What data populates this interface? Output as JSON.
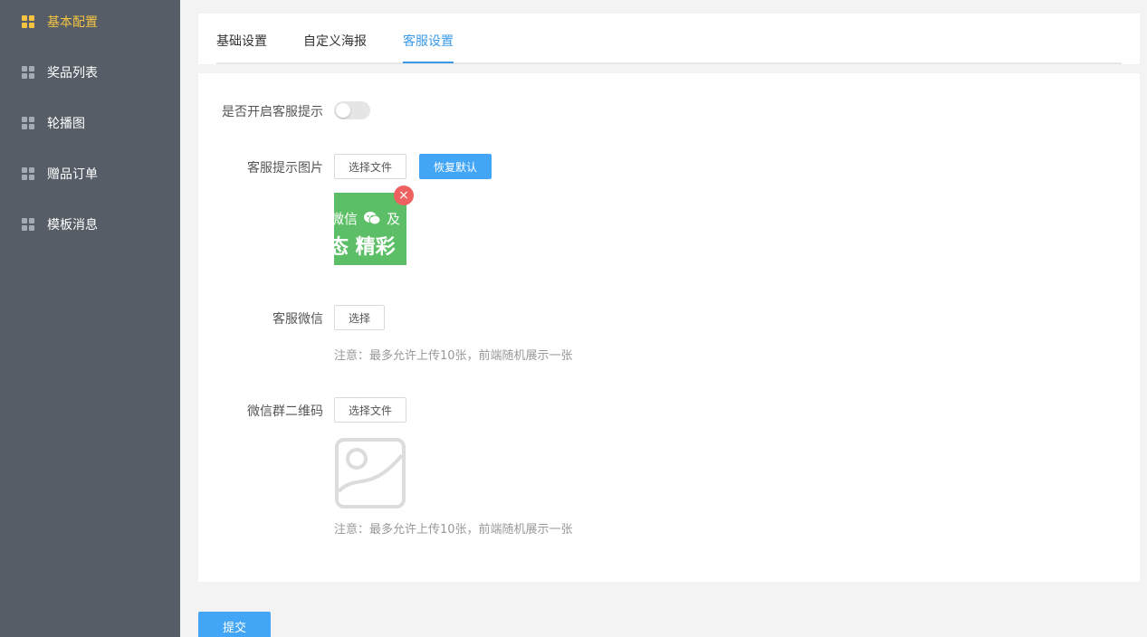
{
  "sidebar": {
    "items": [
      {
        "label": "基本配置",
        "icon": "grid-icon",
        "active": true
      },
      {
        "label": "奖品列表",
        "icon": "grid-icon",
        "active": false
      },
      {
        "label": "轮播图",
        "icon": "grid-icon",
        "active": false
      },
      {
        "label": "赠品订单",
        "icon": "grid-icon",
        "active": false
      },
      {
        "label": "模板消息",
        "icon": "grid-icon",
        "active": false
      }
    ]
  },
  "tabs": [
    {
      "label": "基础设置",
      "active": false
    },
    {
      "label": "自定义海报",
      "active": false
    },
    {
      "label": "客服设置",
      "active": true
    }
  ],
  "form": {
    "enable_label": "是否开启客服提示",
    "enable_value": false,
    "image_label": "客服提示图片",
    "choose_file_label": "选择文件",
    "restore_default_label": "恢复默认",
    "thumb_text_row1": "微信",
    "thumb_text_row1b": "及",
    "thumb_text_row2": "态 精彩",
    "wechat_label": "客服微信",
    "choose_label": "选择",
    "wechat_hint": "注意：最多允许上传10张，前端随机展示一张",
    "qrcode_label": "微信群二维码",
    "qrcode_choose_label": "选择文件",
    "qrcode_hint": "注意：最多允许上传10张，前端随机展示一张"
  },
  "submit_label": "提交",
  "colors": {
    "sidebar_bg": "#565d66",
    "active_accent": "#f5c542",
    "primary_blue": "#42a5f5",
    "tab_active": "#3a9ae8",
    "delete_red": "#ef6161"
  }
}
